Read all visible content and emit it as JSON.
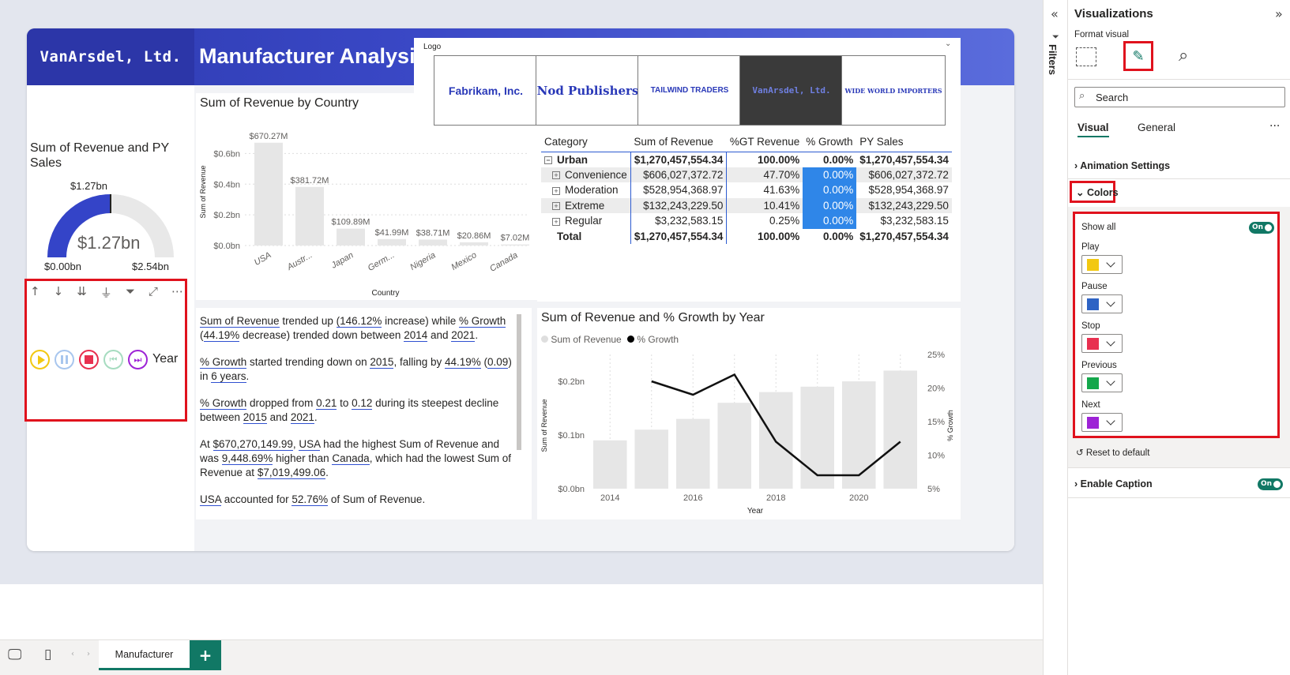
{
  "header": {
    "brand": "VanArsdel, Ltd.",
    "title": "Manufacturer Analysis"
  },
  "gauge": {
    "title": "Sum of Revenue and PY Sales",
    "target": "$1.27bn",
    "value": "$1.27bn",
    "min": "$0.00bn",
    "max": "$2.54bn",
    "fill_fraction": 0.5
  },
  "play_axis": {
    "label": "Year"
  },
  "logo_slicer": {
    "title": "Logo",
    "items": [
      "Fabrikam, Inc.",
      "Nod Publishers",
      "TAILWIND TRADERS",
      "VanArsdel, Ltd.",
      "WIDE WORLD IMPORTERS"
    ],
    "selected_index": 3
  },
  "bar_chart": {
    "title": "Sum of Revenue by Country",
    "ylabel": "Sum of Revenue",
    "xlabel": "Country"
  },
  "line_chart": {
    "title": "Sum of Revenue and % Growth by Year",
    "legend": [
      "Sum of Revenue",
      "% Growth"
    ],
    "ylabel": "Sum of Revenue",
    "y2label": "% Growth",
    "xlabel": "Year"
  },
  "chart_data": [
    {
      "type": "bar",
      "title": "Sum of Revenue by Country",
      "categories": [
        "USA",
        "Austr...",
        "Japan",
        "Germ...",
        "Nigeria",
        "Mexico",
        "Canada"
      ],
      "values": [
        670.27,
        381.72,
        109.89,
        41.99,
        38.71,
        20.86,
        7.02
      ],
      "data_labels": [
        "$670.27M",
        "$381.72M",
        "$109.89M",
        "$41.99M",
        "$38.71M",
        "$20.86M",
        "$7.02M"
      ],
      "yticks": [
        "$0.0bn",
        "$0.2bn",
        "$0.4bn",
        "$0.6bn"
      ],
      "ylim": [
        0,
        0.7
      ],
      "xlabel": "Country",
      "ylabel": "Sum of Revenue"
    },
    {
      "type": "bar+line",
      "title": "Sum of Revenue and % Growth by Year",
      "x": [
        2014,
        2015,
        2016,
        2017,
        2018,
        2019,
        2020,
        2021
      ],
      "xticks": [
        "2014",
        "2016",
        "2018",
        "2020"
      ],
      "series": [
        {
          "name": "Sum of Revenue",
          "type": "bar",
          "values": [
            0.09,
            0.11,
            0.13,
            0.16,
            0.18,
            0.19,
            0.2,
            0.22
          ]
        },
        {
          "name": "% Growth",
          "type": "line",
          "values": [
            null,
            0.21,
            0.19,
            0.22,
            0.12,
            0.07,
            0.07,
            0.12
          ]
        }
      ],
      "yticks": [
        "$0.0bn",
        "$0.1bn",
        "$0.2bn"
      ],
      "y2ticks": [
        "5%",
        "10%",
        "15%",
        "20%",
        "25%"
      ],
      "ylim": [
        0,
        0.25
      ],
      "y2lim": [
        0.05,
        0.25
      ]
    }
  ],
  "matrix": {
    "columns": [
      "Category",
      "Sum of Revenue",
      "%GT Revenue",
      "% Growth",
      "PY Sales"
    ],
    "rows": [
      [
        "Urban",
        "$1,270,457,554.34",
        "100.00%",
        "0.00%",
        "$1,270,457,554.34"
      ],
      [
        "Convenience",
        "$606,027,372.72",
        "47.70%",
        "0.00%",
        "$606,027,372.72"
      ],
      [
        "Moderation",
        "$528,954,368.97",
        "41.63%",
        "0.00%",
        "$528,954,368.97"
      ],
      [
        "Extreme",
        "$132,243,229.50",
        "10.41%",
        "0.00%",
        "$132,243,229.50"
      ],
      [
        "Regular",
        "$3,232,583.15",
        "0.25%",
        "0.00%",
        "$3,232,583.15"
      ]
    ],
    "total": [
      "Total",
      "$1,270,457,554.34",
      "100.00%",
      "0.00%",
      "$1,270,457,554.34"
    ]
  },
  "narrative": {
    "p1": [
      "Sum of Revenue",
      " trended up ",
      "(146.12%",
      " increase) while ",
      "% Growth",
      " (",
      "44.19%",
      " decrease) trended down between ",
      "2014",
      " and ",
      "2021",
      "."
    ],
    "p2": [
      "% Growth",
      " started trending down on ",
      "2015",
      ", falling by ",
      "44.19%",
      " (",
      "0.09",
      ") in ",
      "6 years",
      "."
    ],
    "p3": [
      "% Growth",
      " dropped from ",
      "0.21",
      " to ",
      "0.12",
      " during its steepest decline between ",
      "2015",
      " and ",
      "2021",
      "."
    ],
    "p4": [
      "At ",
      "$670,270,149.99",
      ", ",
      "USA",
      " had the highest Sum of Revenue and was ",
      "9,448.69%",
      " higher than ",
      "Canada",
      ", which had the lowest Sum of Revenue at ",
      "$7,019,499.06",
      "."
    ],
    "p5": [
      "USA",
      " accounted for ",
      "52.76%",
      " of Sum of Revenue."
    ]
  },
  "pane": {
    "filters_label": "Filters",
    "title": "Visualizations",
    "subtitle": "Format visual",
    "search_placeholder": "Search",
    "tabs": [
      "Visual",
      "General"
    ],
    "more": "···",
    "sections": {
      "animation": "Animation Settings",
      "colors": "Colors",
      "caption": "Enable Caption",
      "reset": "Reset to default"
    },
    "show_all": "Show all",
    "toggle_on": "On",
    "colors": [
      {
        "label": "Play",
        "hex": "#f2c811"
      },
      {
        "label": "Pause",
        "hex": "#2e63c4"
      },
      {
        "label": "Stop",
        "hex": "#e8304f"
      },
      {
        "label": "Previous",
        "hex": "#14a74b"
      },
      {
        "label": "Next",
        "hex": "#9d23d6"
      }
    ]
  },
  "tabs": {
    "page": "Manufacturer",
    "add": "+"
  }
}
